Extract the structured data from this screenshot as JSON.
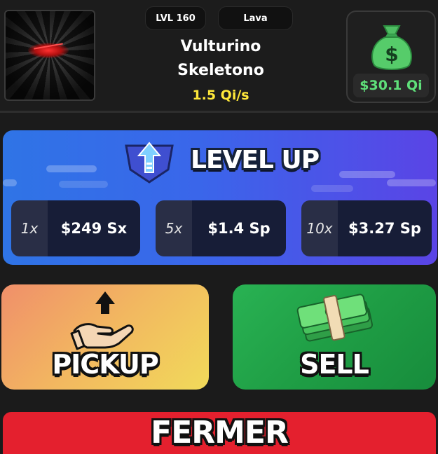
{
  "pet": {
    "level": "LVL 160",
    "mutation": "Lava",
    "name_line1": "Vulturino",
    "name_line2": "Skeletono",
    "rate": "1.5 Qi/s"
  },
  "sell_value": {
    "amount": "$30.1 Qi",
    "icon": "money-bag-icon"
  },
  "level_up": {
    "title": "LEVEL UP",
    "options": [
      {
        "multiplier": "1x",
        "price": "$249 Sx"
      },
      {
        "multiplier": "5x",
        "price": "$1.4 Sp"
      },
      {
        "multiplier": "10x",
        "price": "$3.27 Sp"
      }
    ]
  },
  "actions": {
    "pickup_label": "PICKUP",
    "sell_label": "SELL"
  },
  "bottom_button": {
    "label": "FERMER"
  },
  "colors": {
    "background": "#1b1b1b",
    "rate_yellow": "#ffe83a",
    "money_green": "#5fe07a",
    "level_up_blue": "#3a66ea",
    "sell_green": "#1f9e45",
    "pickup_orange": "#f2b860",
    "bottom_red": "#e4202e"
  }
}
